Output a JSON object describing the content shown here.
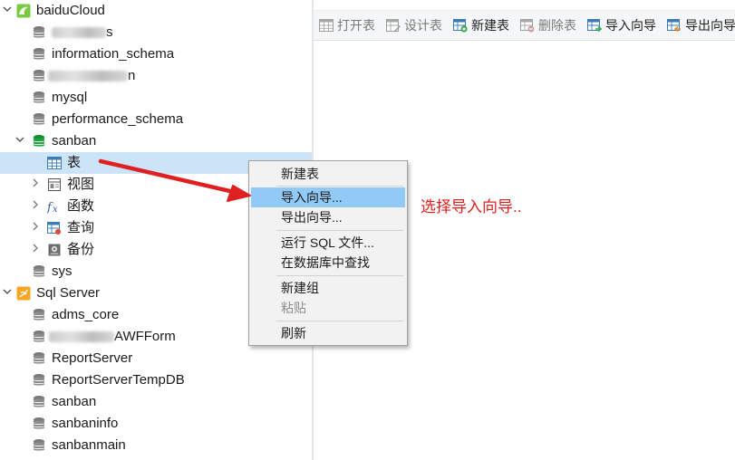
{
  "toolbar": {
    "open_table": "打开表",
    "design_table": "设计表",
    "new_table": "新建表",
    "delete_table": "删除表",
    "import_wizard": "导入向导",
    "export_wizard": "导出向导"
  },
  "tree": {
    "connection1": "baiduCloud",
    "db_partial_1": "s",
    "information_schema": "information_schema",
    "db_partial_2": "n",
    "mysql": "mysql",
    "performance_schema": "performance_schema",
    "sanban": "sanban",
    "tables": "表",
    "views": "视图",
    "functions": "函数",
    "queries": "查询",
    "backups": "备份",
    "sys": "sys",
    "connection2": "Sql Server",
    "adms_core": "adms_core",
    "db_partial_3": "AWFForm",
    "report_server": "ReportServer",
    "report_server_temp": "ReportServerTempDB",
    "sanban2": "sanban",
    "sanbaninfo": "sanbaninfo",
    "sanbanmain": "sanbanmain"
  },
  "context_menu": {
    "new_table": "新建表",
    "import_wizard": "导入向导...",
    "export_wizard": "导出向导...",
    "run_sql_file": "运行 SQL 文件...",
    "find_in_database": "在数据库中查找",
    "new_group": "新建组",
    "paste": "粘贴",
    "refresh": "刷新"
  },
  "annotation": {
    "text": "选择导入向导.."
  },
  "colors": {
    "annotation_red": "#e02020",
    "selection": "#cce4f7",
    "menu_highlight": "#91c9f7",
    "db_green": "#1fa33c",
    "navicat_green": "#7ac943",
    "sqlserver_orange": "#f5a623"
  }
}
